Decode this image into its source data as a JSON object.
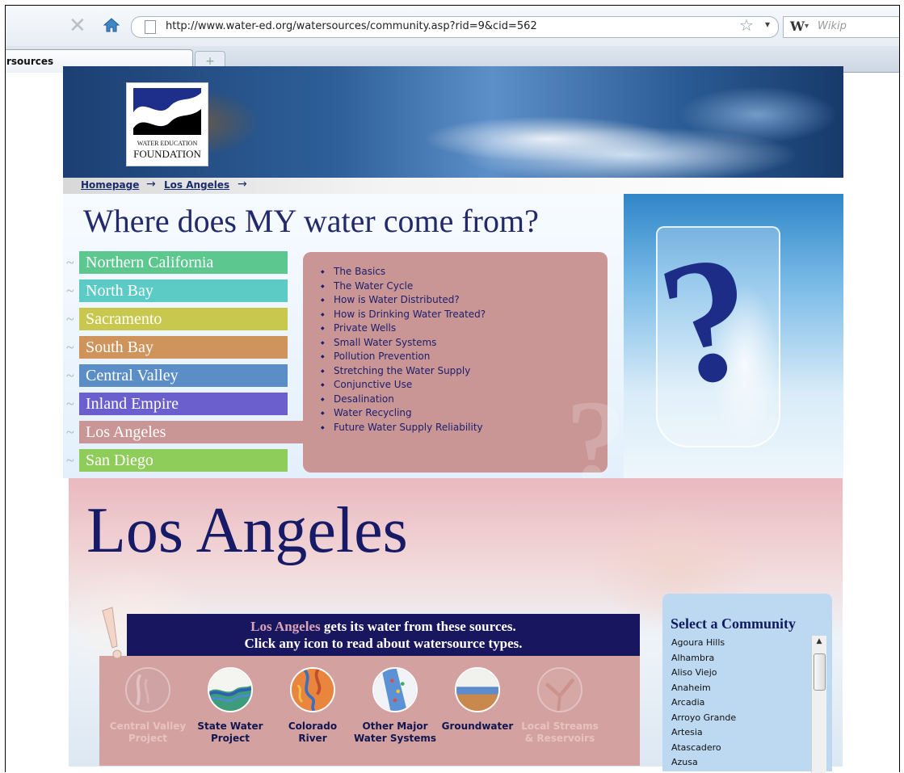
{
  "browser": {
    "url": "http://www.water-ed.org/watersources/community.asp?rid=9&cid=562",
    "search_placeholder": "Wikip",
    "search_engine_icon": "W",
    "tab_title": "rsources",
    "new_tab_label": "+"
  },
  "logo": {
    "line1": "WATER EDUCATION",
    "line2": "FOUNDATION"
  },
  "breadcrumb": {
    "items": [
      "Homepage",
      "Los Angeles"
    ],
    "arrow": "→"
  },
  "headline": "Where does MY water come from?",
  "regions": [
    {
      "label": "Northern California",
      "color": "#5cc78f"
    },
    {
      "label": "North Bay",
      "color": "#5ccac5"
    },
    {
      "label": "Sacramento",
      "color": "#c9c84e"
    },
    {
      "label": "South Bay",
      "color": "#cf935c"
    },
    {
      "label": "Central Valley",
      "color": "#5b8ec6"
    },
    {
      "label": "Inland Empire",
      "color": "#6b5fce"
    },
    {
      "label": "Los Angeles",
      "color": "#c99595"
    },
    {
      "label": "San Diego",
      "color": "#8fcd5a"
    }
  ],
  "topics": [
    "The Basics",
    "The Water Cycle",
    "How is Water Distributed?",
    "How is Drinking Water Treated?",
    "Private Wells",
    "Small Water Systems",
    "Pollution Prevention",
    "Stretching the Water Supply",
    "Conjunctive Use",
    "Desalination",
    "Water Recycling",
    "Future Water Supply Reliability"
  ],
  "community": {
    "title": "Los Angeles",
    "sources_highlight": "Los Angeles",
    "sources_line1_rest": " gets its water from these sources.",
    "sources_line2": "Click any icon to read about watersource types."
  },
  "sources": [
    {
      "label_line1": "Central Valley",
      "label_line2": "Project",
      "active": false,
      "icon": "central-valley-project-icon"
    },
    {
      "label_line1": "State Water",
      "label_line2": "Project",
      "active": true,
      "icon": "state-water-project-icon"
    },
    {
      "label_line1": "Colorado",
      "label_line2": "River",
      "active": true,
      "icon": "colorado-river-icon"
    },
    {
      "label_line1": "Other Major",
      "label_line2": "Water Systems",
      "active": true,
      "icon": "other-water-systems-icon"
    },
    {
      "label_line1": "Groundwater",
      "label_line2": "",
      "active": true,
      "icon": "groundwater-icon"
    },
    {
      "label_line1": "Local Streams",
      "label_line2": "& Reservoirs",
      "active": false,
      "icon": "local-streams-icon"
    }
  ],
  "select_community": {
    "title": "Select a Community",
    "items": [
      "Agoura Hills",
      "Alhambra",
      "Aliso Viejo",
      "Anaheim",
      "Arcadia",
      "Arroyo Grande",
      "Artesia",
      "Atascadero",
      "Azusa"
    ]
  }
}
